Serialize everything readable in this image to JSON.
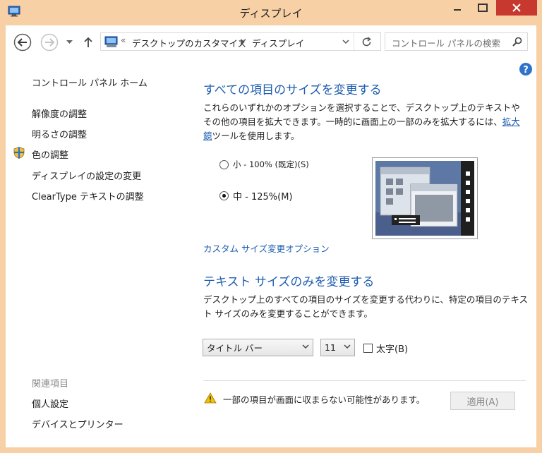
{
  "window": {
    "title": "ディスプレイ"
  },
  "address": {
    "overflow": "«",
    "crumbs": [
      "デスクトップのカスタマイズ",
      "ディスプレイ"
    ],
    "search_placeholder": "コントロール パネルの検索"
  },
  "sidebar": {
    "home": "コントロール パネル ホーム",
    "items": [
      {
        "label": "解像度の調整"
      },
      {
        "label": "明るさの調整"
      },
      {
        "label": "色の調整",
        "icon": "shield-icon"
      },
      {
        "label": "ディスプレイの設定の変更"
      },
      {
        "label": "ClearType テキストの調整"
      }
    ],
    "related_heading": "関連項目",
    "related": [
      "個人設定",
      "デバイスとプリンター"
    ]
  },
  "main": {
    "heading1": "すべての項目のサイズを変更する",
    "desc1_part1": "これらのいずれかのオプションを選択することで、デスクトップ上のテキストやその他の項目を拡大できます。一時的に画面上の一部のみを拡大するには、",
    "desc1_link": "拡大鏡",
    "desc1_part2": "ツールを使用します。",
    "options": [
      {
        "label": "小 - 100% (既定)(S)",
        "checked": false
      },
      {
        "label": "中 - 125%(M)",
        "checked": true
      }
    ],
    "custom_link": "カスタム サイズ変更オプション",
    "heading2": "テキスト サイズのみを変更する",
    "desc2": "デスクトップ上のすべての項目のサイズを変更する代わりに、特定の項目のテキスト サイズのみを変更することができます。",
    "item_select": "タイトル バー",
    "size_select": "11",
    "bold_label": "太字(B)",
    "bold_checked": false,
    "warning": "一部の項目が画面に収まらない可能性があります。",
    "apply": "適用(A)"
  },
  "colors": {
    "accent": "#1e5eb0",
    "frame": "#f8d0a6",
    "close": "#c7382e"
  }
}
